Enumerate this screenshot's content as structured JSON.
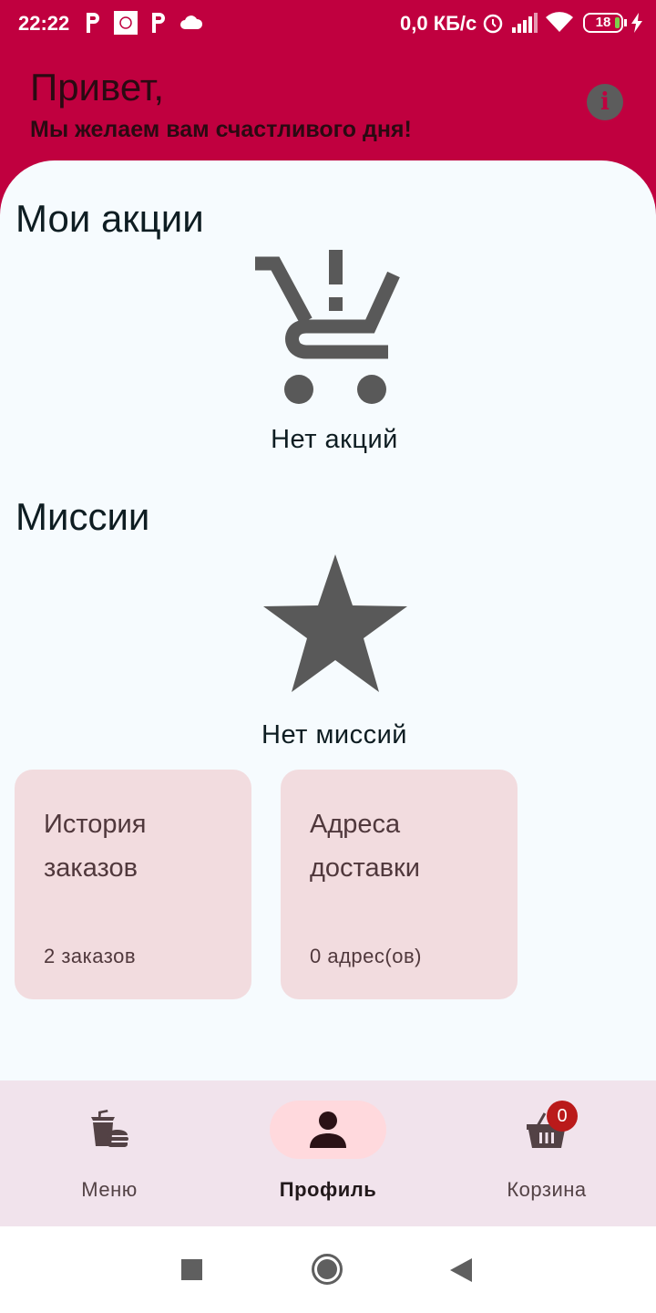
{
  "status_bar": {
    "time": "22:22",
    "network_speed": "0,0 КБ/с",
    "battery_level": "18"
  },
  "header": {
    "greeting": "Привет,",
    "subtitle": "Мы желаем вам счастливого дня!",
    "info_icon": "info-icon"
  },
  "promotions": {
    "title": "Мои акции",
    "empty_icon": "cart-alert-icon",
    "empty_text": "Нет акций"
  },
  "missions": {
    "title": "Миссии",
    "empty_icon": "star-icon",
    "empty_text": "Нет миссий"
  },
  "cards": [
    {
      "title": "История заказов",
      "subtitle": "2 заказов"
    },
    {
      "title": "Адреса доставки",
      "subtitle": "0 адрес(ов)"
    }
  ],
  "bottom_nav": {
    "items": [
      {
        "label": "Меню",
        "icon": "food-icon",
        "active": false
      },
      {
        "label": "Профиль",
        "icon": "person-icon",
        "active": true
      },
      {
        "label": "Корзина",
        "icon": "basket-icon",
        "active": false,
        "badge": "0"
      }
    ]
  },
  "colors": {
    "brand": "#c0003f",
    "surface": "#f6fbfe",
    "card": "#f2dcdf",
    "nav_bg": "#f1e3ec",
    "active_pill": "#ffd9dd",
    "badge": "#ba1a1a"
  }
}
